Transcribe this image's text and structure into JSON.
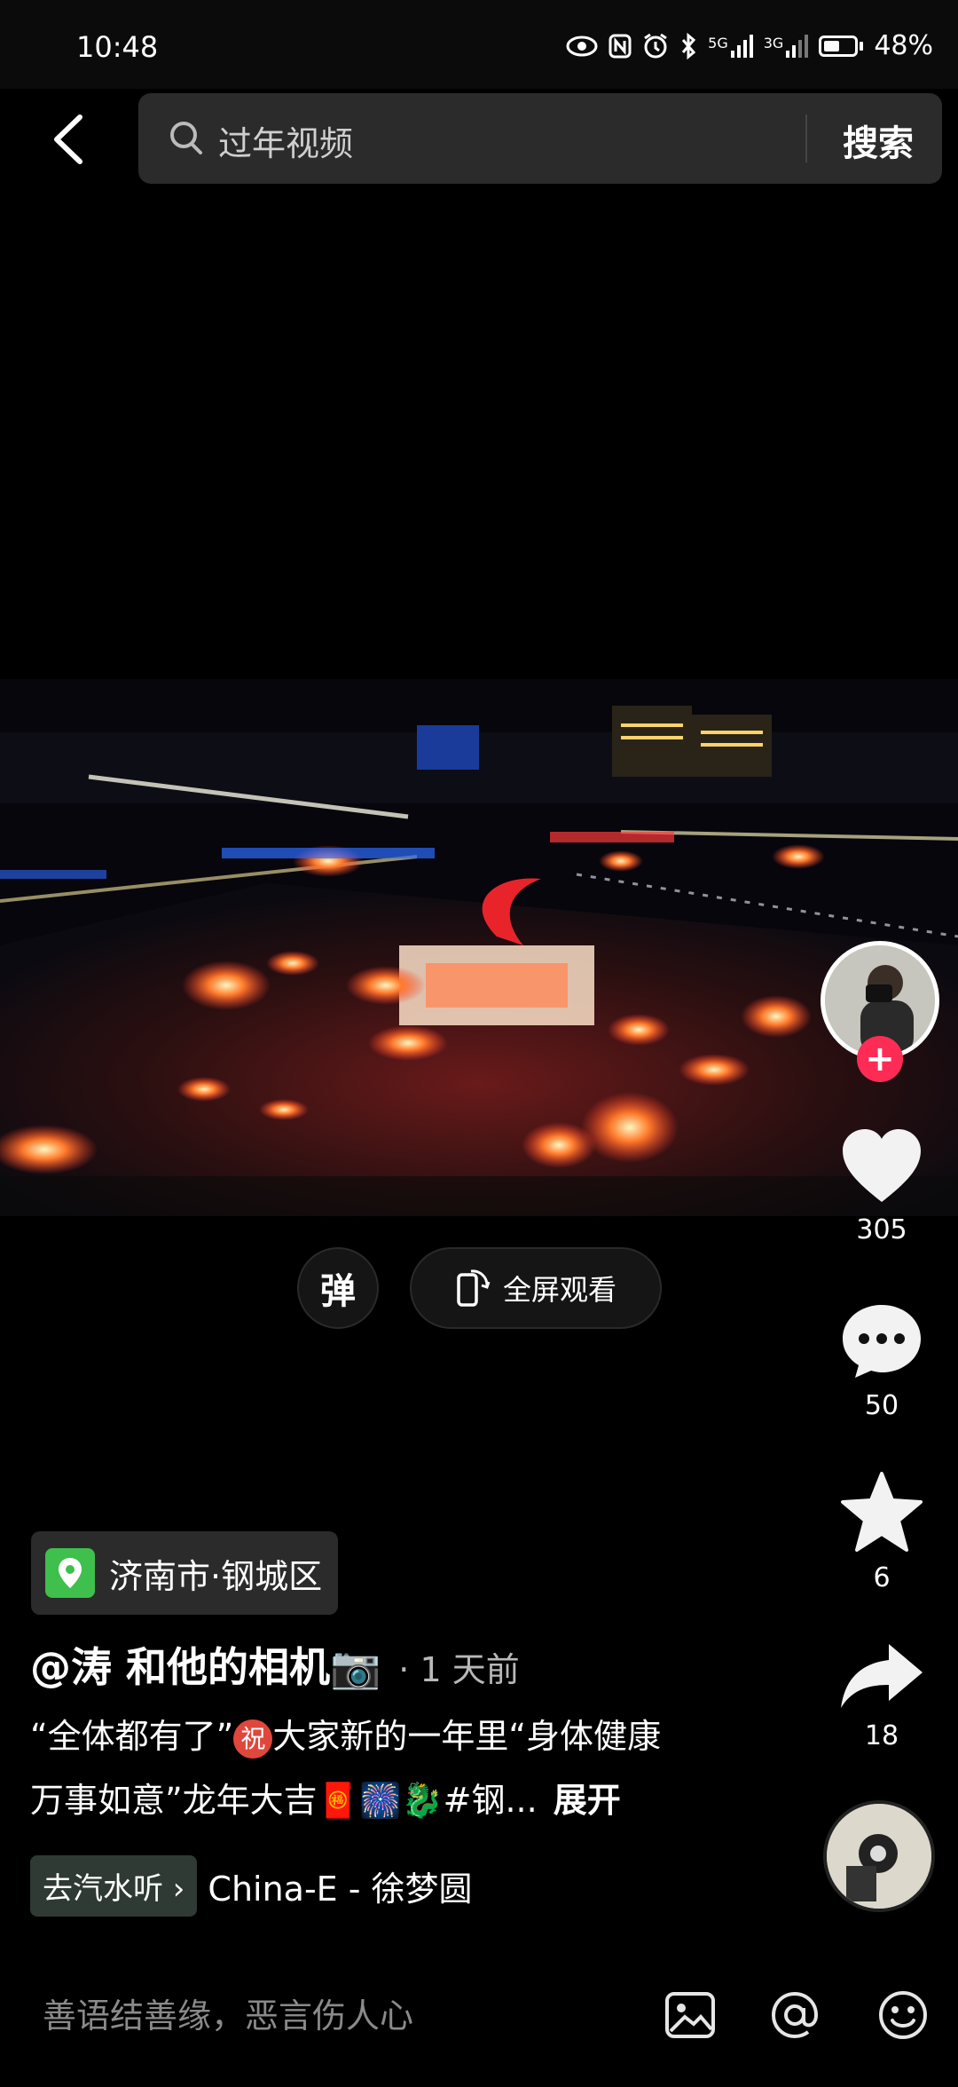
{
  "status_bar": {
    "time": "10:48",
    "net1": "5G",
    "net2": "3G",
    "battery": "48%"
  },
  "search": {
    "query": "过年视频",
    "button": "搜索"
  },
  "video": {
    "danmu_label": "弹",
    "fullscreen_label": "全屏观看"
  },
  "actions": {
    "likes": "305",
    "comments": "50",
    "favorites": "6",
    "shares": "18"
  },
  "post": {
    "location": "济南市·钢城区",
    "author": "@涛 和他的相机📷",
    "time_ago": "· 1 天前",
    "desc_line1_a": "“全体都有了”",
    "zhu_char": "祝",
    "desc_line1_b": "大家新的一年里“身体健康",
    "desc_line2": "万事如意”龙年大吉🧧🎆🐉#钢...",
    "expand": "展开",
    "music_tag": "去汽水听 ›",
    "music": "China-E - 徐梦圆"
  },
  "comment_bar": {
    "placeholder": "善语结善缘，恶言伤人心"
  },
  "colors": {
    "follow": "#fe2c55",
    "location_icon": "#3fbf4b"
  }
}
